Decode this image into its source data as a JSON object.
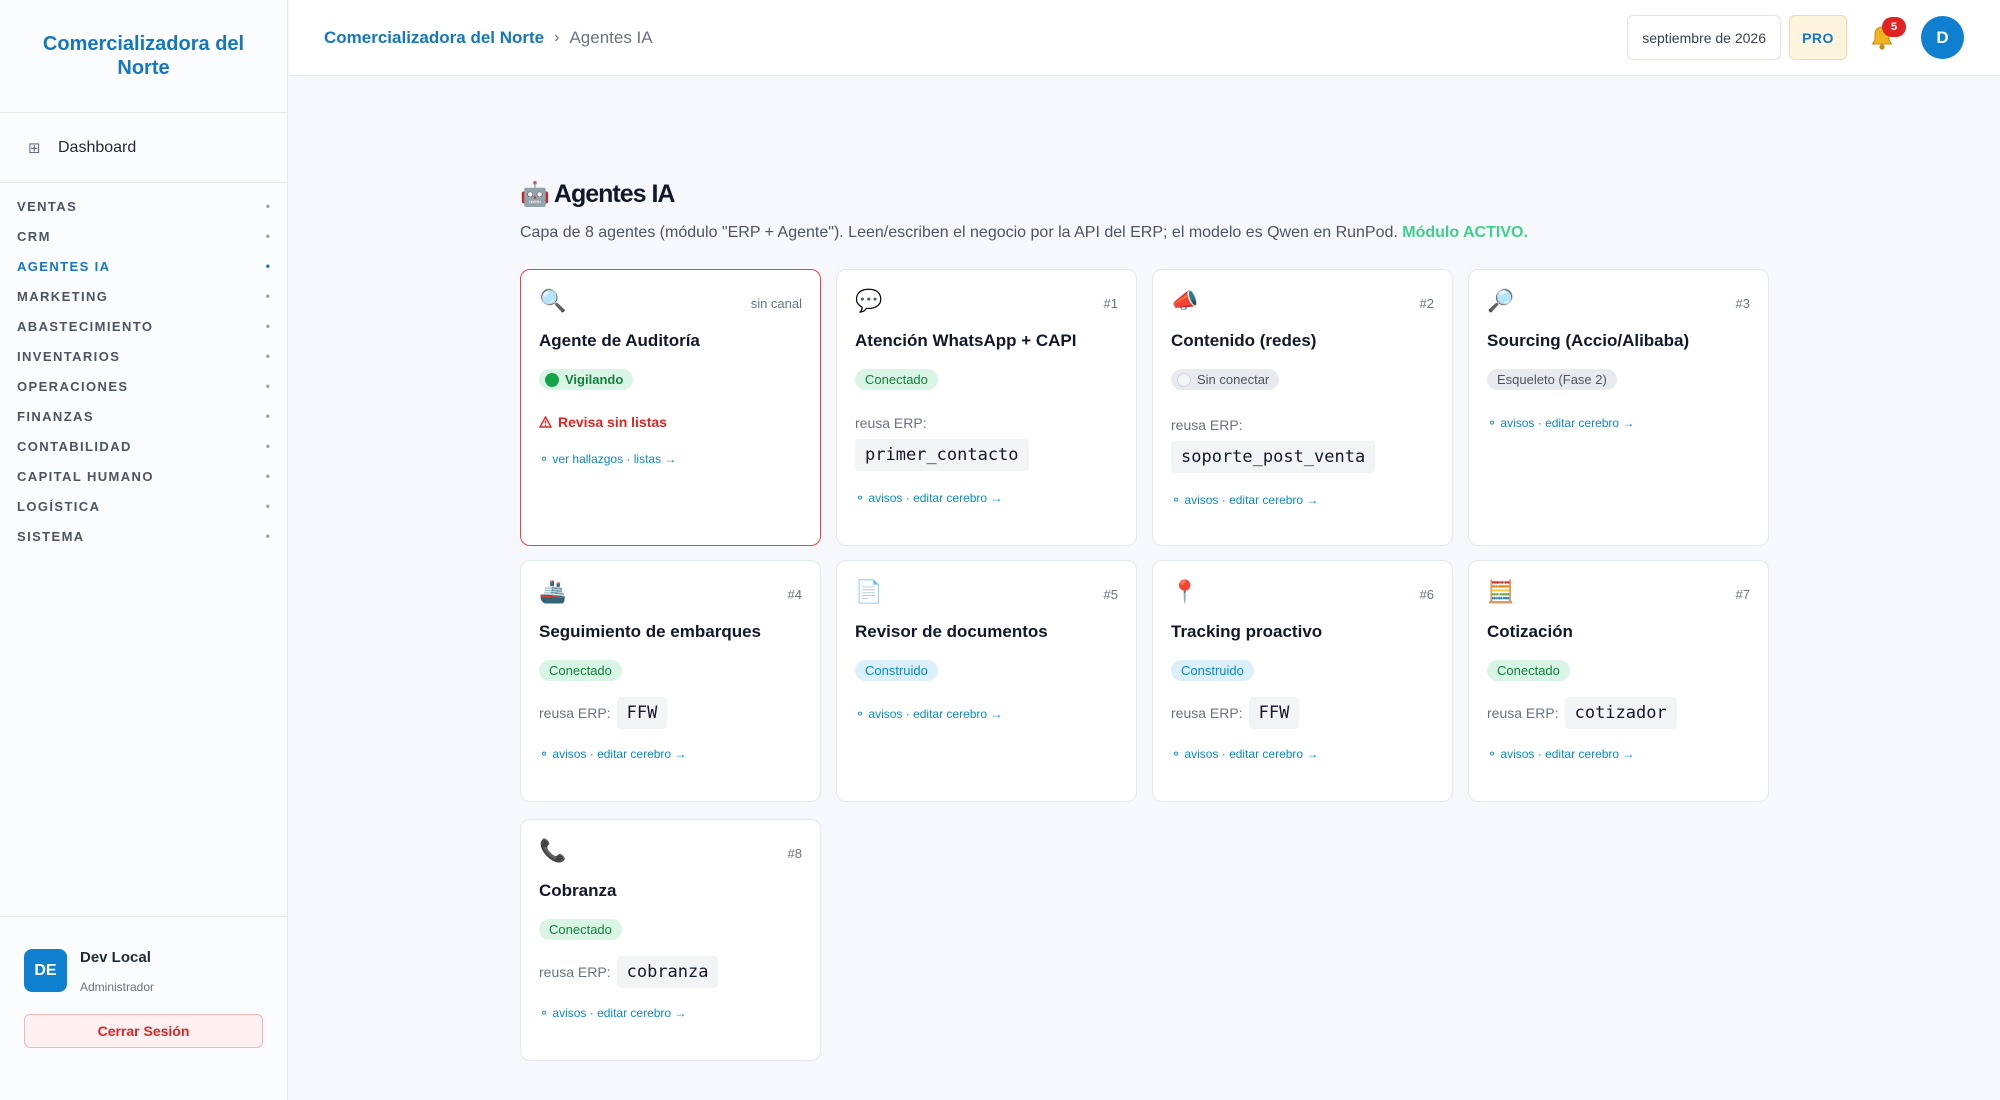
{
  "brand": {
    "name": "Comercializadora del Norte"
  },
  "sidebar": {
    "dashboard_label": "Dashboard",
    "dashboard_icon": "grid-icon",
    "items": [
      {
        "label": "VENTAS"
      },
      {
        "label": "CRM"
      },
      {
        "label": "AGENTES IA",
        "active": true
      },
      {
        "label": "MARKETING"
      },
      {
        "label": "ABASTECIMIENTO"
      },
      {
        "label": "INVENTARIOS"
      },
      {
        "label": "OPERACIONES"
      },
      {
        "label": "FINANZAS"
      },
      {
        "label": "CONTABILIDAD"
      },
      {
        "label": "CAPITAL HUMANO"
      },
      {
        "label": "LOGÍSTICA"
      },
      {
        "label": "SISTEMA"
      }
    ],
    "item_marker": "•",
    "user": {
      "initials": "DE",
      "name": "Dev Local",
      "role": "Administrador"
    },
    "logout_label": "Cerrar Sesión"
  },
  "header": {
    "breadcrumb": {
      "root": "Comercializadora del Norte",
      "sep": "›",
      "current": "Agentes IA"
    },
    "date": "septiembre de 2026",
    "plan": "PRO",
    "notifications": "5",
    "avatar": "D"
  },
  "page": {
    "icon": "🤖",
    "title": "Agentes IA",
    "subtitle": "Capa de 8 agentes (módulo \"ERP + Agente\"). Leen/escriben el negocio por la API del ERP; el modelo es Qwen en RunPod. ",
    "module_status": "Módulo ACTIVO."
  },
  "cards": {
    "reuse_label": "reusa ERP:",
    "audit": {
      "icon": "🔍",
      "channel": "sin canal",
      "title": "Agente de Auditoría",
      "status": "Vigilando",
      "warning": "Revisa sin listas",
      "links": "⚬ ver hallazgos · listas →"
    },
    "a1": {
      "icon": "💬",
      "num": "#1",
      "title": "Atención WhatsApp + CAPI",
      "status": "Conectado",
      "erp": "primer_contacto",
      "links": "⚬ avisos · editar cerebro →"
    },
    "a2": {
      "icon": "📣",
      "num": "#2",
      "title": "Contenido (redes)",
      "status": "Sin conectar",
      "erp": "soporte_post_venta",
      "links": "⚬ avisos · editar cerebro →"
    },
    "a3": {
      "icon": "🔎",
      "num": "#3",
      "title": "Sourcing (Accio/Alibaba)",
      "status": "Esqueleto (Fase 2)",
      "links": "⚬ avisos · editar cerebro →"
    },
    "a4": {
      "icon": "🚢",
      "num": "#4",
      "title": "Seguimiento de embarques",
      "status": "Conectado",
      "erp": "FFW",
      "links": "⚬ avisos · editar cerebro →"
    },
    "a5": {
      "icon": "📄",
      "num": "#5",
      "title": "Revisor de documentos",
      "status": "Construido",
      "links": "⚬ avisos · editar cerebro →"
    },
    "a6": {
      "icon": "📍",
      "num": "#6",
      "title": "Tracking proactivo",
      "status": "Construido",
      "erp": "FFW",
      "links": "⚬ avisos · editar cerebro →"
    },
    "a7": {
      "icon": "🧮",
      "num": "#7",
      "title": "Cotización",
      "status": "Conectado",
      "erp": "cotizador",
      "links": "⚬ avisos · editar cerebro →"
    },
    "a8": {
      "icon": "📞",
      "num": "#8",
      "title": "Cobranza",
      "status": "Conectado",
      "erp": "cobranza",
      "links": "⚬ avisos · editar cerebro →"
    }
  },
  "colors": {
    "brand": "#1577c0",
    "active": "#3fcf8e",
    "alert": "#ef4444",
    "badge": "#e02424"
  }
}
